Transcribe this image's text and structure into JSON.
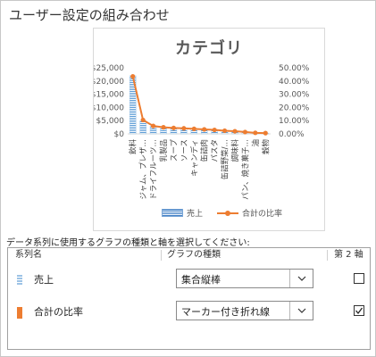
{
  "dialog": {
    "title": "ユーザー設定の組み合わせ",
    "instruction": "データ系列に使用するグラフの種類と軸を選択してください:"
  },
  "table": {
    "headers": {
      "series_name": "系列名",
      "chart_type": "グラフの種類",
      "secondary_axis": "第 2 軸"
    },
    "rows": [
      {
        "name": "売上",
        "chart_type": "集合縦棒",
        "secondary_axis": false,
        "icon": "clustered-column-series-icon",
        "color": "#5b9bd5"
      },
      {
        "name": "合計の比率",
        "chart_type": "マーカー付き折れ線",
        "secondary_axis": true,
        "icon": "line-series-icon",
        "color": "#ed7d31"
      }
    ]
  },
  "chart_data": {
    "type": "bar",
    "title": "カテゴリ",
    "categories": [
      "飲料",
      "ジャム、プレザ…",
      "ドライフルーツ…",
      "乳製品",
      "スープ",
      "ソース",
      "キャンディ",
      "缶詰肉",
      "パスタ",
      "缶詰野菜/…",
      "調味料",
      "パン、焼き菓子…",
      "油",
      "穀物"
    ],
    "series": [
      {
        "name": "売上",
        "axis": "primary",
        "values": [
          22000,
          5000,
          3000,
          2500,
          2300,
          2100,
          1900,
          1700,
          1500,
          1200,
          1000,
          700,
          400,
          300
        ]
      },
      {
        "name": "合計の比率",
        "axis": "secondary",
        "type": "line",
        "values": [
          43.5,
          10.5,
          6.0,
          5.0,
          4.5,
          4.2,
          3.8,
          3.4,
          3.0,
          2.4,
          2.0,
          1.4,
          0.8,
          0.6
        ]
      }
    ],
    "y_ticks": [
      "$0",
      "$5,000",
      "$10,000",
      "$15,000",
      "$20,000",
      "$25,000"
    ],
    "y2_ticks": [
      "0.00%",
      "10.00%",
      "20.00%",
      "30.00%",
      "40.00%",
      "50.00%"
    ],
    "ylim": [
      0,
      25000
    ],
    "y2lim": [
      0,
      50
    ],
    "grid": false,
    "legend_position": "bottom",
    "colors": {
      "bar": "#5b9bd5",
      "line": "#ed7d31"
    }
  }
}
